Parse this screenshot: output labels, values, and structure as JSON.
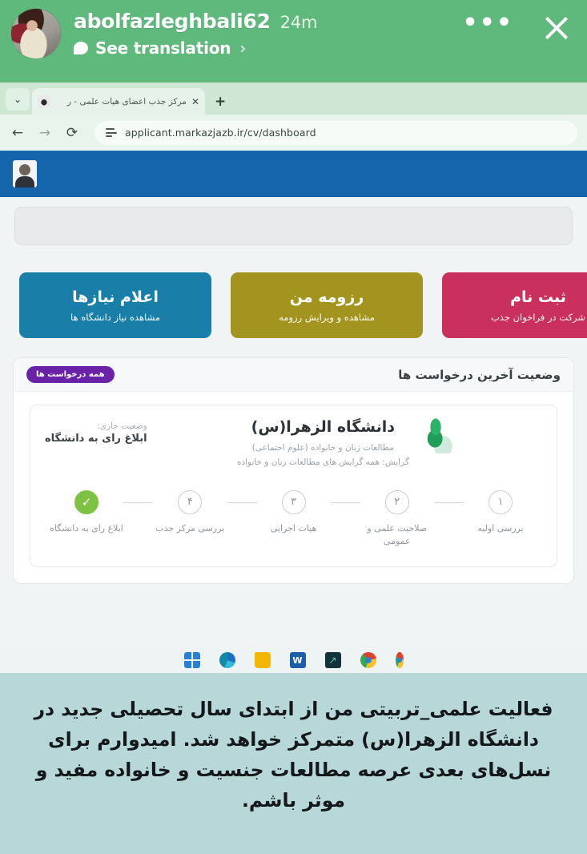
{
  "story": {
    "username": "abolfazleghbali62",
    "timestamp": "24m",
    "translation_label": "See translation",
    "translation_chevron": "›",
    "more_label": "•••",
    "close_label": "✕",
    "bubble_icon": "speech-bubble-icon",
    "background_color": "#5fb87c"
  },
  "browser": {
    "tab_list_icon": "⌄",
    "tab": {
      "favicon_icon": "iran-emblem-favicon",
      "favicon_glyph": "۞",
      "title": "مرکز جذب اعضای هیأت علمی - ر",
      "close_label": "✕"
    },
    "new_tab_label": "+",
    "back_label": "←",
    "forward_label": "→",
    "reload_label": "⟳",
    "site_info_icon": "site-settings-icon",
    "url": "applicant.markazjazb.ir/cv/dashboard"
  },
  "app": {
    "header_color": "#1565ac",
    "avatar_icon": "user-avatar",
    "cards": [
      {
        "title": "اعلام نیازها",
        "subtitle": "مشاهده نیاز دانشگاه ها",
        "color": "#1a7fa8",
        "name": "announce-needs-card"
      },
      {
        "title": "رزومه من",
        "subtitle": "مشاهده و ویرایش رزومه",
        "color": "#a39420",
        "name": "my-resume-card"
      },
      {
        "title": "ثبت نام",
        "subtitle": "شرکت در فراخوان جذب",
        "color": "#c9305e",
        "name": "register-card"
      }
    ],
    "requests_panel": {
      "title": "وضعیت آخرین درخواست ها",
      "badge_label": "همه درخواست ها",
      "badge_color": "#6a23a8",
      "request": {
        "university_name": "دانشگاه الزهرا(س)",
        "field_line_1": "مطالعات زنان و خانواده (علوم اجتماعی)",
        "field_line_2": "گرایش: همه گرایش های مطالعات زنان و خانواده",
        "logo_icon": "alzahra-university-logo",
        "current_status_label": "وضعیت جاری:",
        "current_status_value": "ابلاغ رای به دانشگاه",
        "steps": [
          {
            "marker": "۱",
            "label": "بررسی اولیه",
            "done": false
          },
          {
            "marker": "۲",
            "label": "صلاحیت علمی و عمومی",
            "done": false
          },
          {
            "marker": "۳",
            "label": "هیات اجرایی",
            "done": false
          },
          {
            "marker": "۴",
            "label": "بررسی مرکز جذب",
            "done": false
          },
          {
            "marker": "✓",
            "label": "ابلاغ رای به دانشگاه",
            "done": true
          }
        ],
        "done_color": "#7dc243"
      }
    },
    "taskbar_icons": [
      "windows-start-icon",
      "edge-icon",
      "file-explorer-icon",
      "word-icon",
      "app-icon",
      "chrome-icon",
      "partial-icon"
    ]
  },
  "caption": {
    "background_color": "#b7d7d8",
    "text": "فعالیت علمی_تربیتی من از ابتدای سال تحصیلی جدید در دانشگاه الزهرا(س) متمرکز خواهد شد. امیدوارم برای نسل‌های بعدی عرصه مطالعات جنسیت و خانواده مفید و موثر باشم."
  }
}
